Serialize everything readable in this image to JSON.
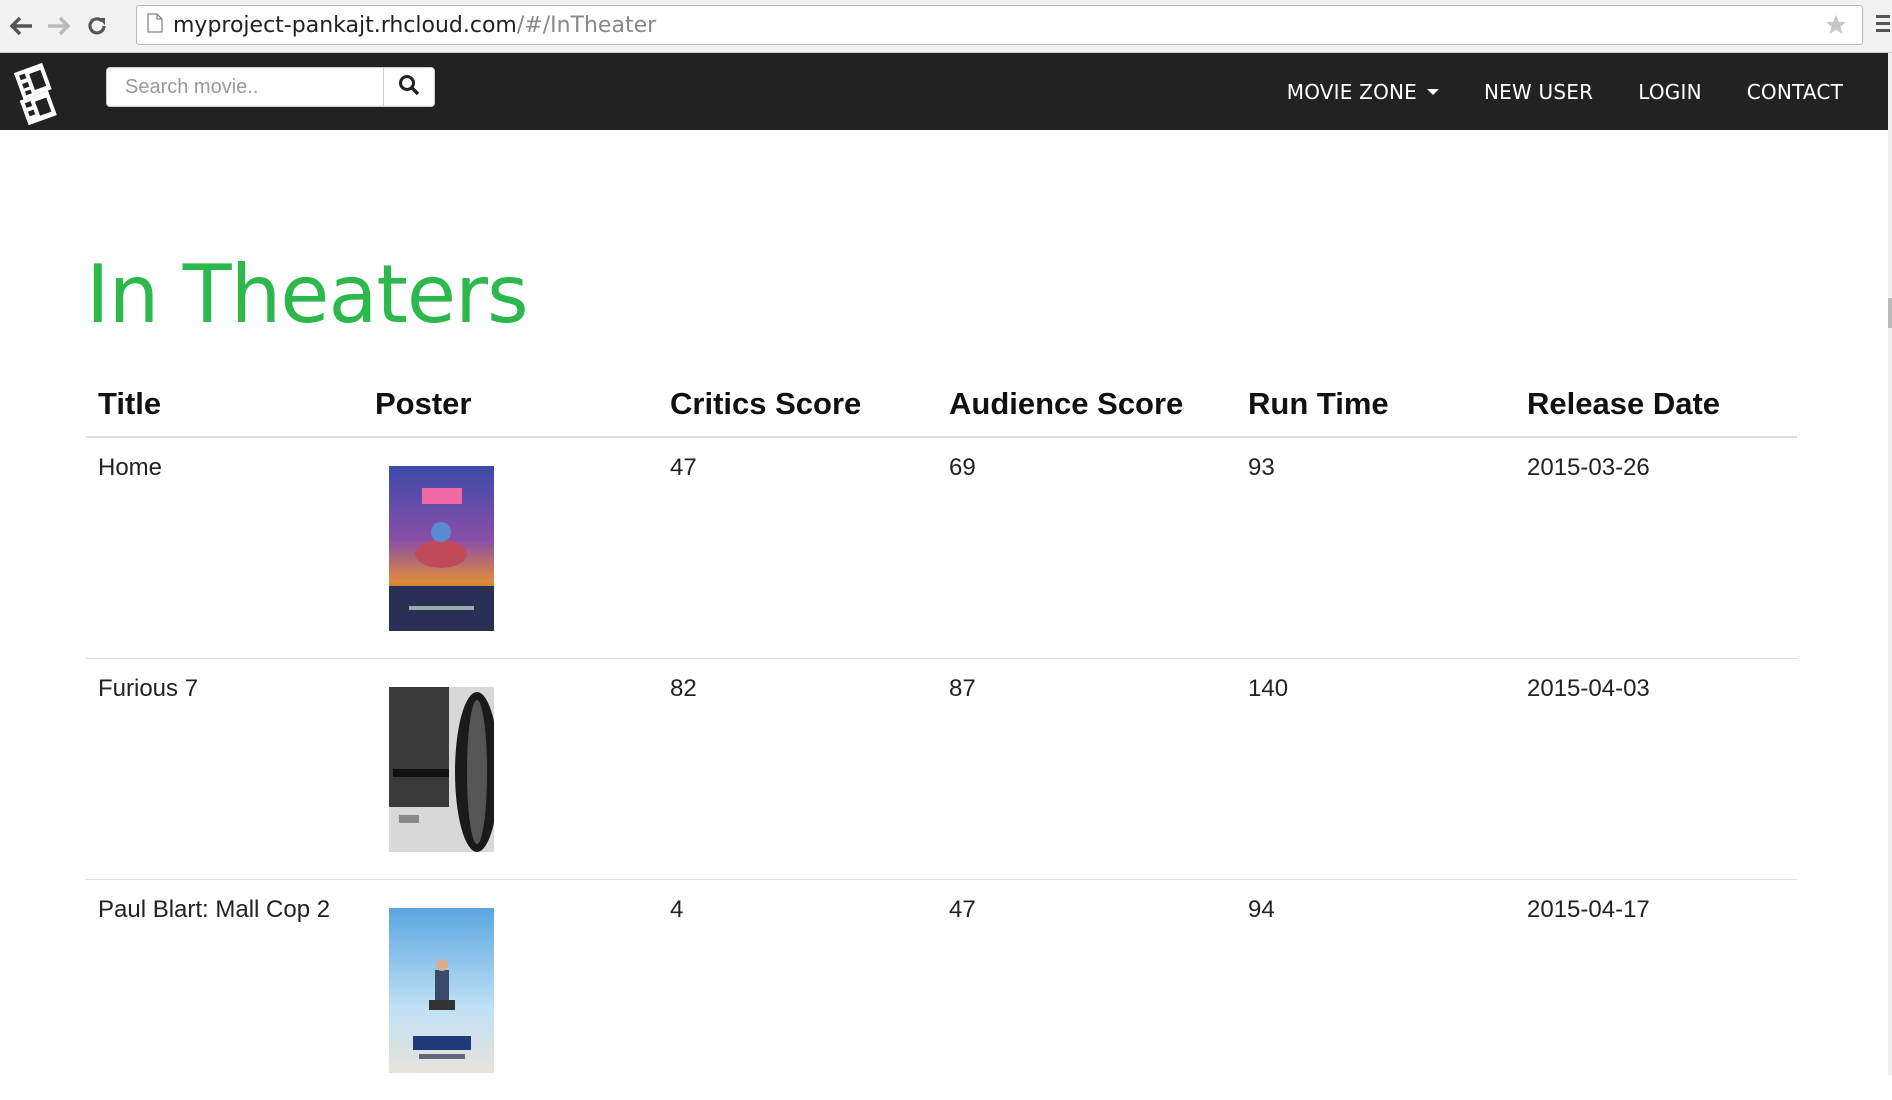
{
  "browser": {
    "url_host": "myproject-pankajt.rhcloud.com",
    "url_path": "/#/InTheater"
  },
  "navbar": {
    "search_placeholder": "Search movie..",
    "links": [
      "MOVIE ZONE",
      "NEW USER",
      "LOGIN",
      "CONTACT"
    ]
  },
  "page": {
    "title": "In Theaters",
    "title_color": "#2db84d"
  },
  "table": {
    "headers": [
      "Title",
      "Poster",
      "Critics Score",
      "Audience Score",
      "Run Time",
      "Release Date"
    ],
    "rows": [
      {
        "title": "Home",
        "critics": "47",
        "audience": "69",
        "runtime": "93",
        "release": "2015-03-26"
      },
      {
        "title": "Furious 7",
        "critics": "82",
        "audience": "87",
        "runtime": "140",
        "release": "2015-04-03"
      },
      {
        "title": "Paul Blart: Mall Cop 2",
        "critics": "4",
        "audience": "47",
        "runtime": "94",
        "release": "2015-04-17"
      }
    ]
  }
}
